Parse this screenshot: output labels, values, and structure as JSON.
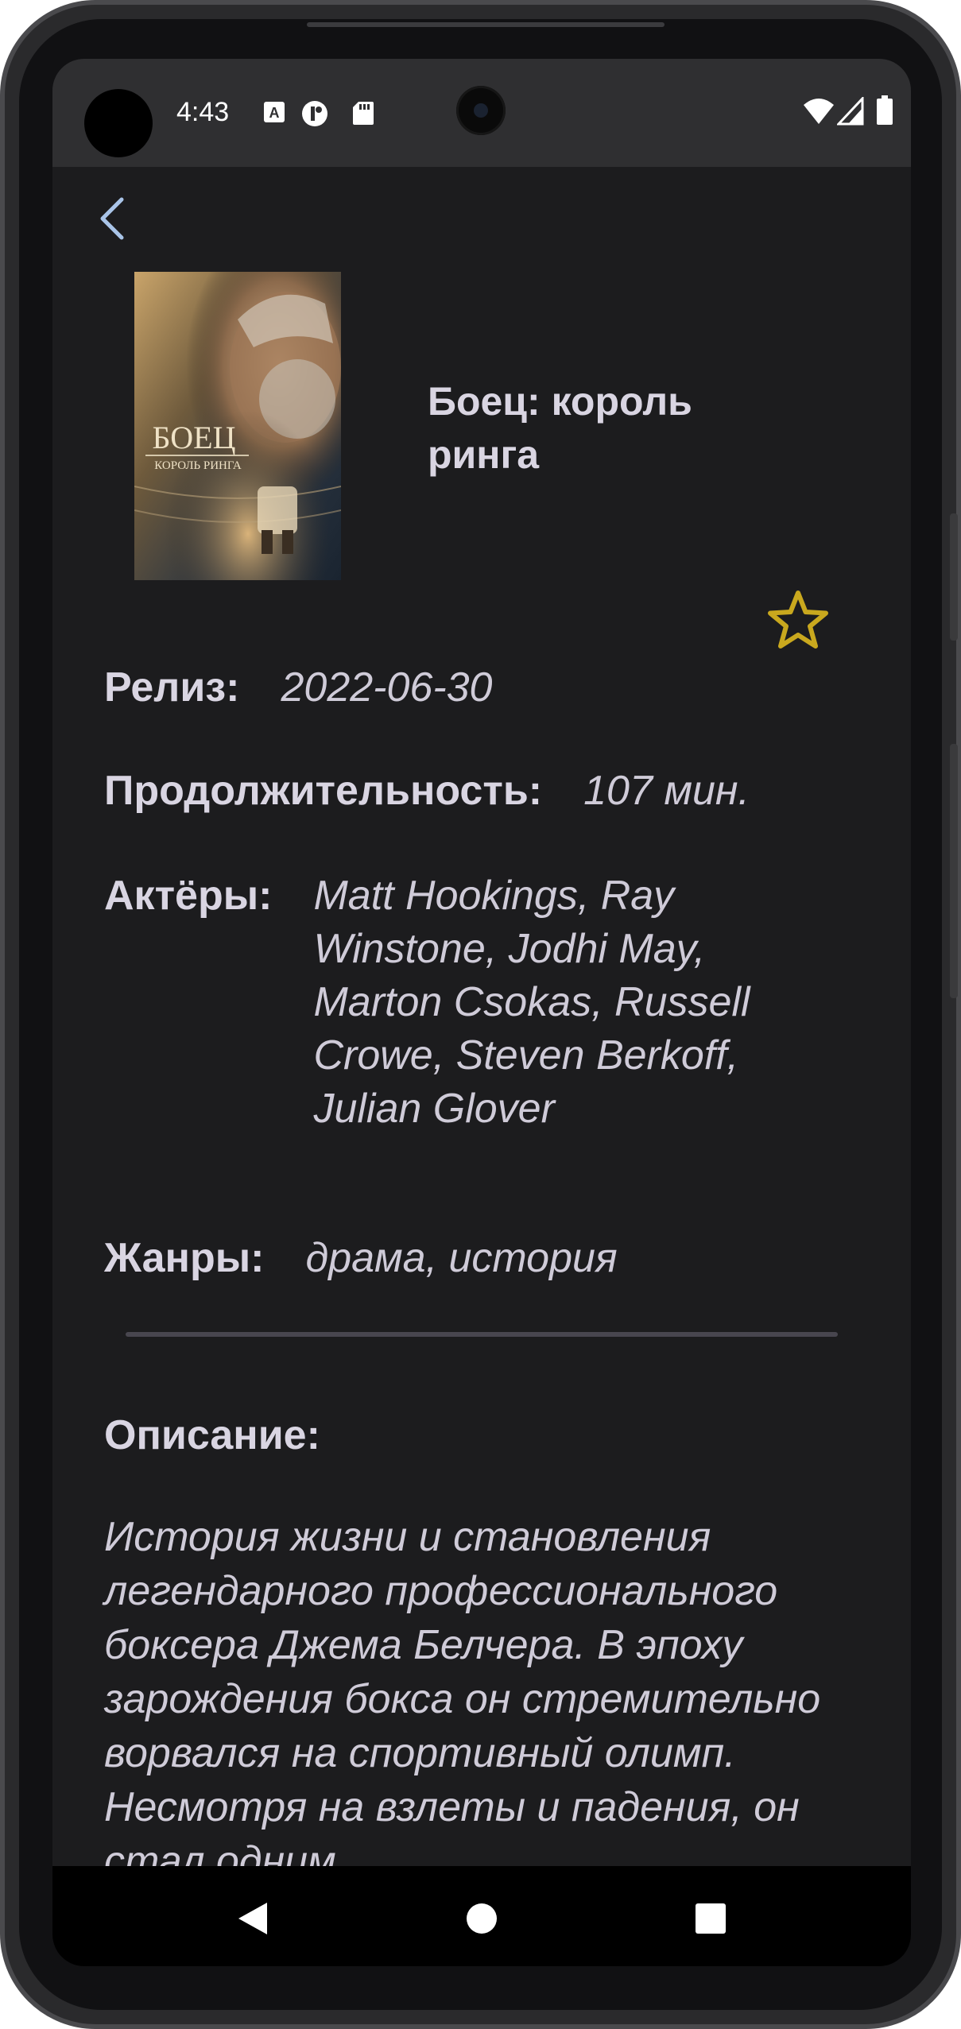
{
  "status_bar": {
    "time": "4:43",
    "icons": [
      "a-accessibility-icon",
      "media-icon",
      "sd-card-icon",
      "wifi-icon",
      "signal-icon",
      "battery-icon"
    ]
  },
  "nav": {
    "back_icon": "chevron-left-icon"
  },
  "movie": {
    "poster_title": "БОЕЦ",
    "poster_subtitle": "КОРОЛЬ РИНГА",
    "title": "Боец: король ринга",
    "favorite_icon": "star-outline-icon",
    "release_label": "Релиз:",
    "release_value": "2022-06-30",
    "duration_label": "Продолжительность:",
    "duration_value": "107 мин.",
    "actors_label": "Актёры:",
    "actors_value": "Matt Hookings, Ray Winstone, Jodhi May, Marton Csokas, Russell Crowe, Steven Berkoff, Julian Glover",
    "genres_label": "Жанры:",
    "genres_value": "драма, история",
    "description_label": "Описание:",
    "description_text": "История жизни и становления легендарного профессионального боксера Джема Белчера. В эпоху зарождения бокса он стремительно ворвался на спортивный олимп. Несмотря на взлеты и падения, он стал одним"
  },
  "system_nav": {
    "icons": [
      "back-triangle-icon",
      "home-circle-icon",
      "recents-square-icon"
    ]
  },
  "colors": {
    "background": "#1c1c1e",
    "text": "#d9d5e2",
    "accent_star": "#c9a81e",
    "divider": "#48464f"
  }
}
